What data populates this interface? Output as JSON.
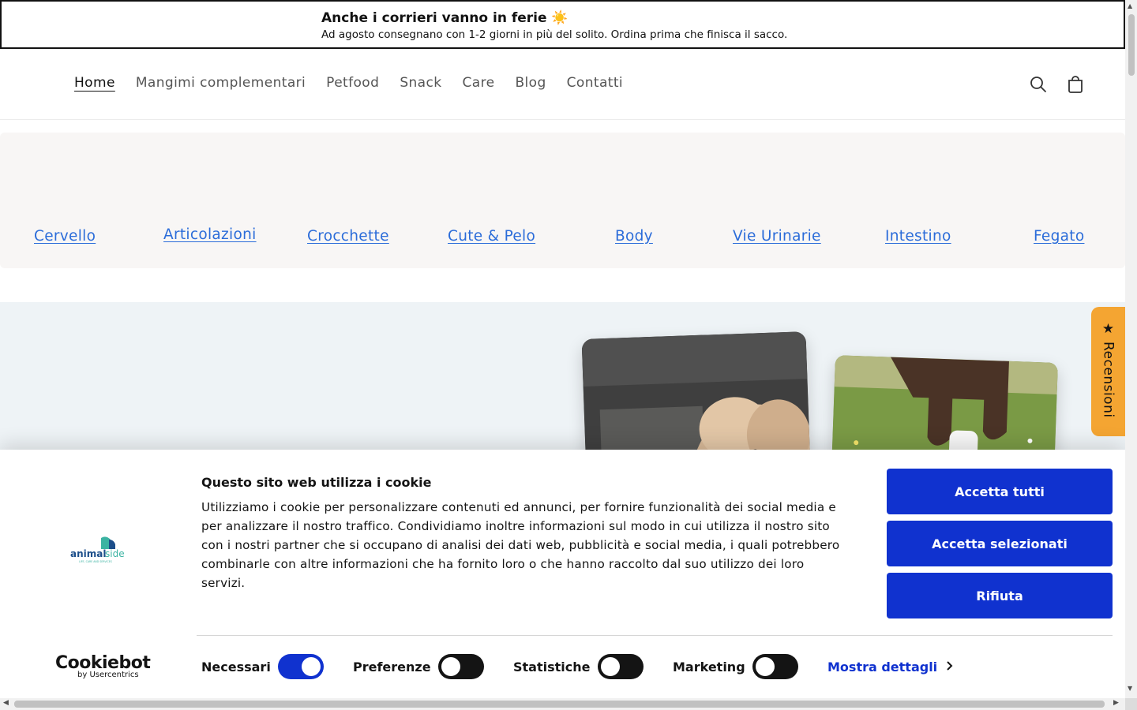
{
  "announcement": {
    "title": "Anche i corrieri vanno in ferie ☀️",
    "subtitle": "Ad agosto consegnano con 1-2 giorni in più del solito. Ordina prima che finisca il sacco."
  },
  "nav": {
    "items": [
      "Home",
      "Mangimi complementari",
      "Petfood",
      "Snack",
      "Care",
      "Blog",
      "Contatti"
    ],
    "active": "Home",
    "icons": [
      "search-icon",
      "cart-icon"
    ]
  },
  "categories": [
    "Cervello",
    "Articolazioni",
    "Crocchette",
    "Cute & Pelo",
    "Body",
    "Vie Urinarie",
    "Intestino",
    "Fegato"
  ],
  "reviews_tab": {
    "star": "★",
    "label": "Recensioni"
  },
  "cookie_banner": {
    "title": "Questo sito web utilizza i cookie",
    "text": "Utilizziamo i cookie per personalizzare contenuti ed annunci, per fornire funzionalità dei social media e per analizzare il nostro traffico. Condividiamo inoltre informazioni sul modo in cui utilizza il nostro sito con i nostri partner che si occupano di analisi dei dati web, pubblicità e social media, i quali potrebbero combinarle con altre informazioni che ha fornito loro o che hanno raccolto dal suo utilizzo dei loro servizi.",
    "buttons": {
      "accept_all": "Accetta tutti",
      "accept_selected": "Accetta selezionati",
      "reject": "Rifiuta"
    },
    "toggles": [
      {
        "label": "Necessari",
        "on": true
      },
      {
        "label": "Preferenze",
        "on": false
      },
      {
        "label": "Statistiche",
        "on": false
      },
      {
        "label": "Marketing",
        "on": false
      }
    ],
    "details_link": "Mostra dettagli",
    "logo_text": "animalside",
    "logo_tagline": "LIFE, CARE AND SERVICES",
    "brand": "Cookiebot",
    "brand_sub": "by Usercentrics",
    "colors": {
      "primary": "#1032cf",
      "toggle_off": "#141414"
    }
  },
  "colors": {
    "category_link": "#2b6cd9",
    "reviews_tab": "#f4a532",
    "hero_bg": "#eef3f6",
    "category_bg": "#f8f6f5"
  }
}
